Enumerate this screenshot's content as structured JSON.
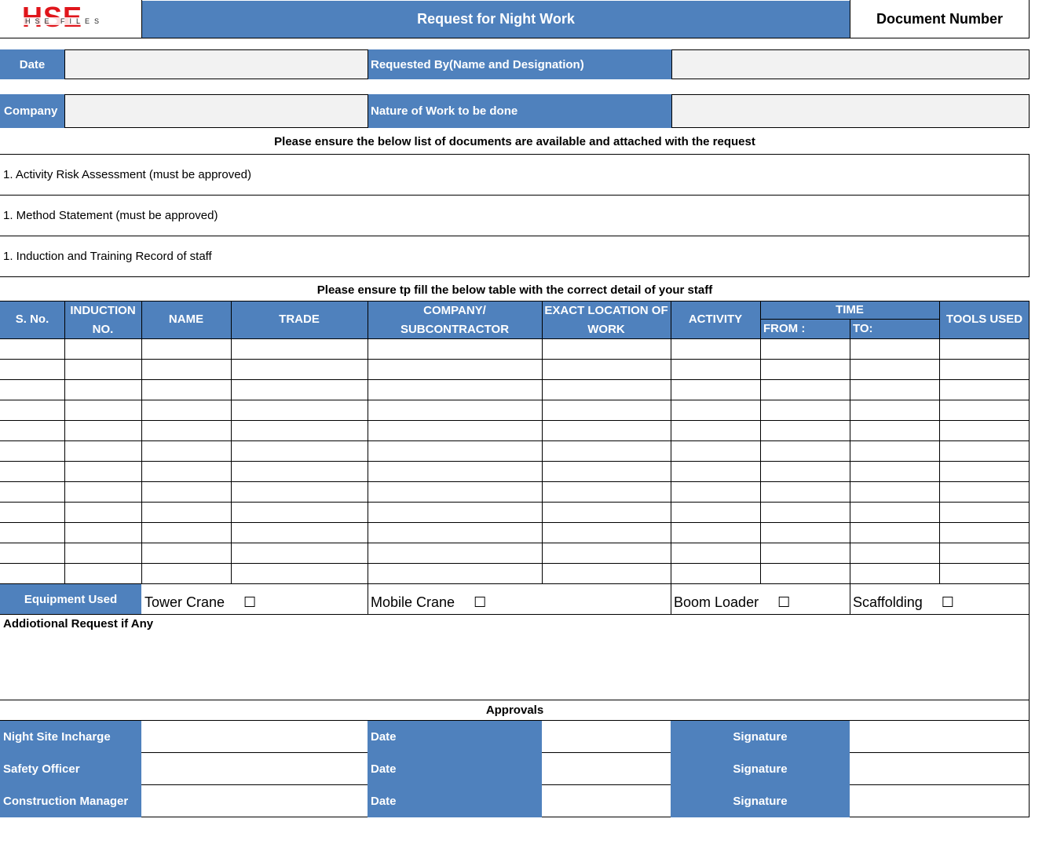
{
  "header": {
    "logo_main": "HSE",
    "logo_sub": "HSE FILES",
    "title": "Request for Night Work",
    "document_number_label": "Document Number"
  },
  "info": {
    "date_label": "Date",
    "date_value": "",
    "requested_by_label": "Requested By(Name and Designation)",
    "requested_by_value": "",
    "company_label": "Company",
    "company_value": "",
    "nature_label": "Nature of Work to be done",
    "nature_value": ""
  },
  "documents": {
    "heading": "Please ensure the below list of documents are available and attached with the request",
    "items": [
      "1. Activity Risk Assessment (must be approved)",
      "1. Method Statement (must be approved)",
      "1. Induction and Training Record of staff"
    ]
  },
  "staff_table": {
    "heading": "Please ensure tp fill the below table with the correct detail of your staff",
    "columns": {
      "sno": "S. No.",
      "induction_1": "INDUCTION",
      "induction_2": "NO.",
      "name": "NAME",
      "trade": "TRADE",
      "company_1": "COMPANY/",
      "company_2": "SUBCONTRACTOR",
      "location_1": "EXACT LOCATION OF",
      "location_2": "WORK",
      "activity": "ACTIVITY",
      "time": "TIME",
      "from": "FROM :",
      "to": "TO:",
      "tools": "TOOLS USED"
    },
    "row_count": 12,
    "rows": [
      [
        "",
        "",
        "",
        "",
        "",
        "",
        "",
        "",
        "",
        ""
      ],
      [
        "",
        "",
        "",
        "",
        "",
        "",
        "",
        "",
        "",
        ""
      ],
      [
        "",
        "",
        "",
        "",
        "",
        "",
        "",
        "",
        "",
        ""
      ],
      [
        "",
        "",
        "",
        "",
        "",
        "",
        "",
        "",
        "",
        ""
      ],
      [
        "",
        "",
        "",
        "",
        "",
        "",
        "",
        "",
        "",
        ""
      ],
      [
        "",
        "",
        "",
        "",
        "",
        "",
        "",
        "",
        "",
        ""
      ],
      [
        "",
        "",
        "",
        "",
        "",
        "",
        "",
        "",
        "",
        ""
      ],
      [
        "",
        "",
        "",
        "",
        "",
        "",
        "",
        "",
        "",
        ""
      ],
      [
        "",
        "",
        "",
        "",
        "",
        "",
        "",
        "",
        "",
        ""
      ],
      [
        "",
        "",
        "",
        "",
        "",
        "",
        "",
        "",
        "",
        ""
      ],
      [
        "",
        "",
        "",
        "",
        "",
        "",
        "",
        "",
        "",
        ""
      ],
      [
        "",
        "",
        "",
        "",
        "",
        "",
        "",
        "",
        "",
        ""
      ]
    ]
  },
  "equipment": {
    "label": "Equipment Used",
    "checkbox_glyph": "☐",
    "items": [
      {
        "label": "Tower Crane",
        "checked": false
      },
      {
        "label": "Mobile Crane",
        "checked": false
      },
      {
        "label": "Boom Loader",
        "checked": false
      },
      {
        "label": "Scaffolding",
        "checked": false
      }
    ]
  },
  "additional": {
    "label": "Addiotional Request if Any",
    "value": ""
  },
  "approvals": {
    "heading": "Approvals",
    "date_label": "Date",
    "signature_label": "Signature",
    "rows": [
      {
        "role": "Night Site Incharge"
      },
      {
        "role": "Safety Officer"
      },
      {
        "role": "Construction Manager"
      }
    ]
  }
}
